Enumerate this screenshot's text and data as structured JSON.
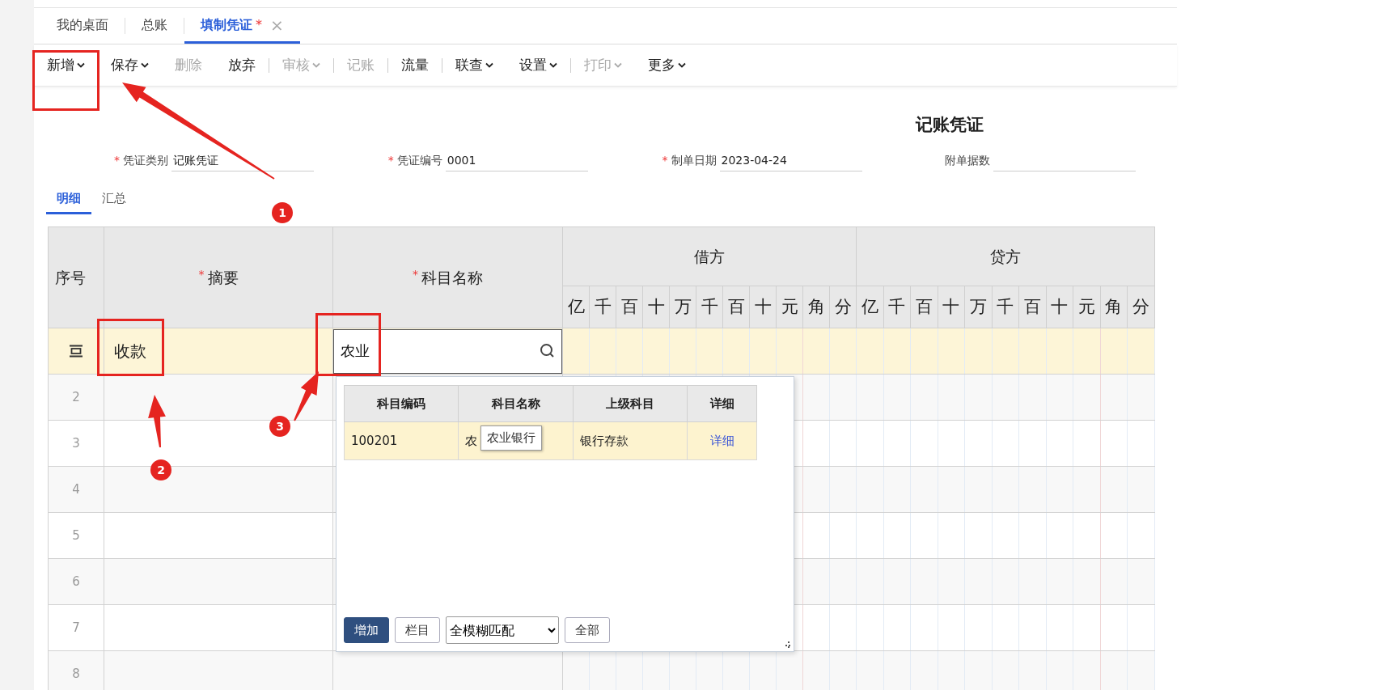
{
  "tabs": [
    {
      "label": "我的桌面",
      "selected": false
    },
    {
      "label": "总账",
      "selected": false
    },
    {
      "label": "填制凭证",
      "selected": true,
      "modified_mark": "*",
      "close_glyph": "×"
    }
  ],
  "toolbar": [
    {
      "label": "新增",
      "dropdown": true,
      "disabled": false,
      "separator_after": false
    },
    {
      "label": "保存",
      "dropdown": true,
      "disabled": false,
      "separator_after": false
    },
    {
      "label": "删除",
      "dropdown": false,
      "disabled": true,
      "separator_after": false
    },
    {
      "label": "放弃",
      "dropdown": false,
      "disabled": false,
      "separator_after": true
    },
    {
      "label": "审核",
      "dropdown": true,
      "disabled": true,
      "separator_after": true
    },
    {
      "label": "记账",
      "dropdown": false,
      "disabled": true,
      "separator_after": true
    },
    {
      "label": "流量",
      "dropdown": false,
      "disabled": false,
      "separator_after": true
    },
    {
      "label": "联查",
      "dropdown": true,
      "disabled": false,
      "separator_after": false
    },
    {
      "label": "设置",
      "dropdown": true,
      "disabled": false,
      "separator_after": true
    },
    {
      "label": "打印",
      "dropdown": true,
      "disabled": true,
      "separator_after": false
    },
    {
      "label": "更多",
      "dropdown": true,
      "disabled": false,
      "separator_after": false
    }
  ],
  "voucher": {
    "title": "记账凭证",
    "fields": [
      {
        "label": "凭证类别",
        "required_mark": "*",
        "value": "记账凭证"
      },
      {
        "label": "凭证编号",
        "required_mark": "*",
        "value": "0001"
      },
      {
        "label": "制单日期",
        "required_mark": "*",
        "value": "2023-04-24"
      },
      {
        "label": "附单据数"
      }
    ]
  },
  "subtabs": [
    {
      "label": "明细",
      "selected": true
    },
    {
      "label": "汇总",
      "selected": false
    }
  ],
  "grid": {
    "index_header": "序号",
    "summary_header": {
      "label": "摘要",
      "required_mark": "*"
    },
    "account_header": {
      "label": "科目名称",
      "required_mark": "*"
    },
    "debit": {
      "label": "借方",
      "digits": [
        "亿",
        "千",
        "百",
        "十",
        "万",
        "千",
        "百",
        "十",
        "元",
        "角",
        "分"
      ]
    },
    "credit": {
      "label": "贷方",
      "digits": [
        "亿",
        "千",
        "百",
        "十",
        "万",
        "千",
        "百",
        "十",
        "元",
        "角",
        "分"
      ]
    },
    "rows": [
      {
        "kind": "editing",
        "selected": true,
        "summary": "收款",
        "account_input": "农业"
      },
      {
        "kind": "empty",
        "selected": false,
        "index": "2"
      },
      {
        "kind": "empty",
        "selected": false,
        "index": "3"
      },
      {
        "kind": "empty",
        "selected": false,
        "index": "4"
      },
      {
        "kind": "empty",
        "selected": false,
        "index": "5"
      },
      {
        "kind": "empty",
        "selected": false,
        "index": "6"
      },
      {
        "kind": "empty",
        "selected": false,
        "index": "7"
      },
      {
        "kind": "empty",
        "selected": false,
        "index": "8"
      }
    ]
  },
  "account_popup": {
    "columns": [
      "科目编码",
      "科目名称",
      "上级科目",
      "详细"
    ],
    "rows": [
      {
        "code": "100201",
        "name": "农",
        "parent": "银行存款",
        "detail": "详细",
        "selected": true
      }
    ],
    "tooltip": "农业银行",
    "footer": [
      {
        "kind": "button",
        "label": "增加",
        "primary": true
      },
      {
        "kind": "button",
        "label": "栏目",
        "primary": false
      },
      {
        "kind": "select",
        "value": "全模糊匹配"
      },
      {
        "kind": "button",
        "label": "全部",
        "primary": false
      }
    ]
  },
  "annotations": [
    {
      "step": "1"
    },
    {
      "step": "2"
    },
    {
      "step": "3"
    }
  ]
}
